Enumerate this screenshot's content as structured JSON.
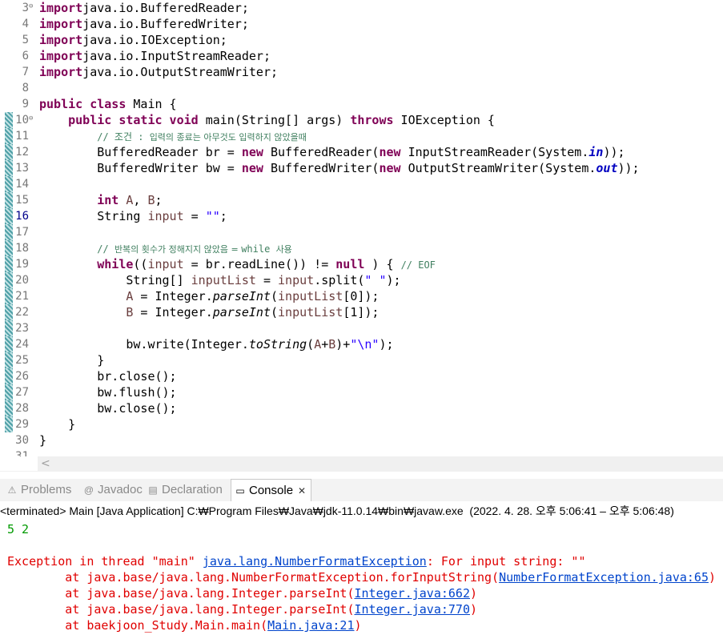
{
  "editor": {
    "lines": [
      {
        "n": "3",
        "fold": "⊖",
        "segs": [
          [
            "kw",
            "import"
          ],
          [
            "",
            "java.io.BufferedReader;"
          ]
        ]
      },
      {
        "n": "4",
        "segs": [
          [
            "kw",
            "import"
          ],
          [
            "",
            "java.io.BufferedWriter;"
          ]
        ]
      },
      {
        "n": "5",
        "segs": [
          [
            "kw",
            "import"
          ],
          [
            "",
            "java.io.IOException;"
          ]
        ]
      },
      {
        "n": "6",
        "segs": [
          [
            "kw",
            "import"
          ],
          [
            "",
            "java.io.InputStreamReader;"
          ]
        ]
      },
      {
        "n": "7",
        "segs": [
          [
            "kw",
            "import"
          ],
          [
            "",
            "java.io.OutputStreamWriter;"
          ]
        ]
      },
      {
        "n": "8",
        "segs": []
      },
      {
        "n": "9",
        "segs": [
          [
            "kw",
            "public class"
          ],
          [
            "",
            " Main {"
          ]
        ]
      },
      {
        "n": "10",
        "fold": "⊖",
        "ov": true,
        "segs": [
          [
            "",
            "    "
          ],
          [
            "kw",
            "public static void"
          ],
          [
            "",
            " main(String[] args) "
          ],
          [
            "kw",
            "throws"
          ],
          [
            "",
            " IOException {"
          ]
        ]
      },
      {
        "n": "11",
        "ov": true,
        "segs": [
          [
            "",
            "        "
          ],
          [
            "cm",
            "// 조건 : "
          ],
          [
            "cmk",
            "입력의 종료는 아무것도 입력하지 않았을때"
          ]
        ]
      },
      {
        "n": "12",
        "ov": true,
        "segs": [
          [
            "",
            "        BufferedReader br = "
          ],
          [
            "kw",
            "new"
          ],
          [
            "",
            " BufferedReader("
          ],
          [
            "kw",
            "new"
          ],
          [
            "",
            " InputStreamReader(System."
          ],
          [
            "fs",
            "in"
          ],
          [
            "",
            "));"
          ]
        ]
      },
      {
        "n": "13",
        "ov": true,
        "segs": [
          [
            "",
            "        BufferedWriter bw = "
          ],
          [
            "kw",
            "new"
          ],
          [
            "",
            " BufferedWriter("
          ],
          [
            "kw",
            "new"
          ],
          [
            "",
            " OutputStreamWriter(System."
          ],
          [
            "fs",
            "out"
          ],
          [
            "",
            "));"
          ]
        ]
      },
      {
        "n": "14",
        "ov": true,
        "segs": []
      },
      {
        "n": "15",
        "ov": true,
        "segs": [
          [
            "",
            "        "
          ],
          [
            "kw",
            "int"
          ],
          [
            "",
            " "
          ],
          [
            "vr",
            "A"
          ],
          [
            "",
            ", "
          ],
          [
            "vr",
            "B"
          ],
          [
            "",
            ";"
          ]
        ]
      },
      {
        "n": "16",
        "ov": true,
        "mk": true,
        "segs": [
          [
            "",
            "        String "
          ],
          [
            "vr",
            "input"
          ],
          [
            "",
            " = "
          ],
          [
            "st",
            "\"\""
          ],
          [
            "",
            ";"
          ]
        ]
      },
      {
        "n": "17",
        "ov": true,
        "segs": []
      },
      {
        "n": "18",
        "ov": true,
        "segs": [
          [
            "",
            "        "
          ],
          [
            "cm",
            "// "
          ],
          [
            "cmk",
            "반복의 횟수가 정해지지 않았음 = "
          ],
          [
            "cm",
            "while "
          ],
          [
            "cmk",
            "사용"
          ]
        ]
      },
      {
        "n": "19",
        "ov": true,
        "segs": [
          [
            "",
            "        "
          ],
          [
            "kw",
            "while"
          ],
          [
            "",
            "(("
          ],
          [
            "vr",
            "input"
          ],
          [
            "",
            " = br.readLine()) != "
          ],
          [
            "kw",
            "null"
          ],
          [
            "",
            " ) { "
          ],
          [
            "cm",
            "// EOF"
          ]
        ]
      },
      {
        "n": "20",
        "ov": true,
        "segs": [
          [
            "",
            "            String[] "
          ],
          [
            "vr",
            "inputList"
          ],
          [
            "",
            " = "
          ],
          [
            "vr",
            "input"
          ],
          [
            "",
            ".split("
          ],
          [
            "st",
            "\" \""
          ],
          [
            "",
            ");"
          ]
        ]
      },
      {
        "n": "21",
        "ov": true,
        "segs": [
          [
            "",
            "            "
          ],
          [
            "vr",
            "A"
          ],
          [
            "",
            " = Integer."
          ],
          [
            "it",
            "parseInt"
          ],
          [
            "",
            "("
          ],
          [
            "vr",
            "inputList"
          ],
          [
            "",
            "[0]);"
          ]
        ]
      },
      {
        "n": "22",
        "ov": true,
        "segs": [
          [
            "",
            "            "
          ],
          [
            "vr",
            "B"
          ],
          [
            "",
            " = Integer."
          ],
          [
            "it",
            "parseInt"
          ],
          [
            "",
            "("
          ],
          [
            "vr",
            "inputList"
          ],
          [
            "",
            "[1]);"
          ]
        ]
      },
      {
        "n": "23",
        "ov": true,
        "segs": []
      },
      {
        "n": "24",
        "ov": true,
        "segs": [
          [
            "",
            "            bw.write(Integer."
          ],
          [
            "it",
            "toString"
          ],
          [
            "",
            "("
          ],
          [
            "vr",
            "A"
          ],
          [
            "",
            "+"
          ],
          [
            "vr",
            "B"
          ],
          [
            "",
            ")+"
          ],
          [
            "st",
            "\"\\n\""
          ],
          [
            "",
            ");"
          ]
        ]
      },
      {
        "n": "25",
        "ov": true,
        "segs": [
          [
            "",
            "        }"
          ]
        ]
      },
      {
        "n": "26",
        "ov": true,
        "segs": [
          [
            "",
            "        br.close();"
          ]
        ]
      },
      {
        "n": "27",
        "ov": true,
        "segs": [
          [
            "",
            "        bw.flush();"
          ]
        ]
      },
      {
        "n": "28",
        "ov": true,
        "segs": [
          [
            "",
            "        bw.close();"
          ]
        ]
      },
      {
        "n": "29",
        "ov": true,
        "segs": [
          [
            "",
            "    }"
          ]
        ]
      },
      {
        "n": "30",
        "segs": [
          [
            "",
            "}"
          ]
        ]
      },
      {
        "n": "31",
        "segs": []
      }
    ]
  },
  "scrollbar": {
    "left_arrow": "<"
  },
  "tabs": [
    {
      "label": "Problems",
      "icon": "⚠",
      "active": false
    },
    {
      "label": "Javadoc",
      "icon": "@",
      "active": false
    },
    {
      "label": "Declaration",
      "icon": "▤",
      "active": false
    },
    {
      "label": "Console",
      "icon": "▭",
      "active": true,
      "close": "✕"
    }
  ],
  "console": {
    "status": "<terminated> Main [Java Application] C:₩Program Files₩Java₩jdk-11.0.14₩bin₩javaw.exe  (2022. 4. 28. 오후 5:06:41 – 오후 5:06:48)",
    "input_line": "5 2",
    "error_lines": [
      {
        "text": "Exception in thread \"main\" ",
        "link": "java.lang.NumberFormatException",
        "after": ": For input string: \"\""
      },
      {
        "text": "        at java.base/java.lang.NumberFormatException.forInputString(",
        "link": "NumberFormatException.java:65",
        "after": ")"
      },
      {
        "text": "        at java.base/java.lang.Integer.parseInt(",
        "link": "Integer.java:662",
        "after": ")"
      },
      {
        "text": "        at java.base/java.lang.Integer.parseInt(",
        "link": "Integer.java:770",
        "after": ")"
      },
      {
        "text": "        at baekjoon_Study.Main.main(",
        "link": "Main.java:21",
        "after": ")"
      }
    ]
  },
  "colors": {
    "keyword": "#7f0055",
    "comment": "#3f7f5f",
    "string": "#2a00ff",
    "static_field": "#0000c0",
    "error": "#e00000",
    "input": "#009a00",
    "link": "#0044cc"
  }
}
